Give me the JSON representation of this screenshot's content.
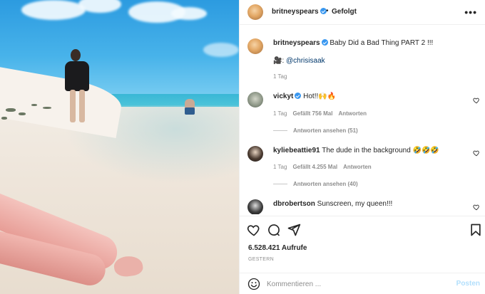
{
  "post": {
    "username": "britneyspears",
    "follow_status": "Gefolgt",
    "more_label": "•••",
    "caption": "Baby Did a Bad Thing PART 2 !!!",
    "credit_emoji": "🎥",
    "credit_mention": "@chrisisaak",
    "age": "1 Tag"
  },
  "comments": [
    {
      "username": "vickyt",
      "verified": true,
      "text": "Hot!!🙌🔥",
      "age": "1 Tag",
      "likes": "Gefällt 756 Mal",
      "reply": "Antworten",
      "view_replies": "Antworten ansehen (51)"
    },
    {
      "username": "kyliebeattie91",
      "verified": false,
      "text": "The dude in the background 🤣🤣🤣",
      "age": "1 Tag",
      "likes": "Gefällt 4.255 Mal",
      "reply": "Antworten",
      "view_replies": "Antworten ansehen (40)"
    },
    {
      "username": "dbrobertson",
      "verified": false,
      "text": "Sunscreen, my queen!!!"
    }
  ],
  "actions": {
    "views": "6.528.421 Aufrufe",
    "posted": "GESTERN"
  },
  "comment_box": {
    "placeholder": "Kommentieren ...",
    "submit_label": "Posten"
  },
  "colors": {
    "verified": "#3897f0",
    "mention": "#00376b",
    "muted": "#8e8e8e",
    "post_disabled": "#b2dffc"
  }
}
